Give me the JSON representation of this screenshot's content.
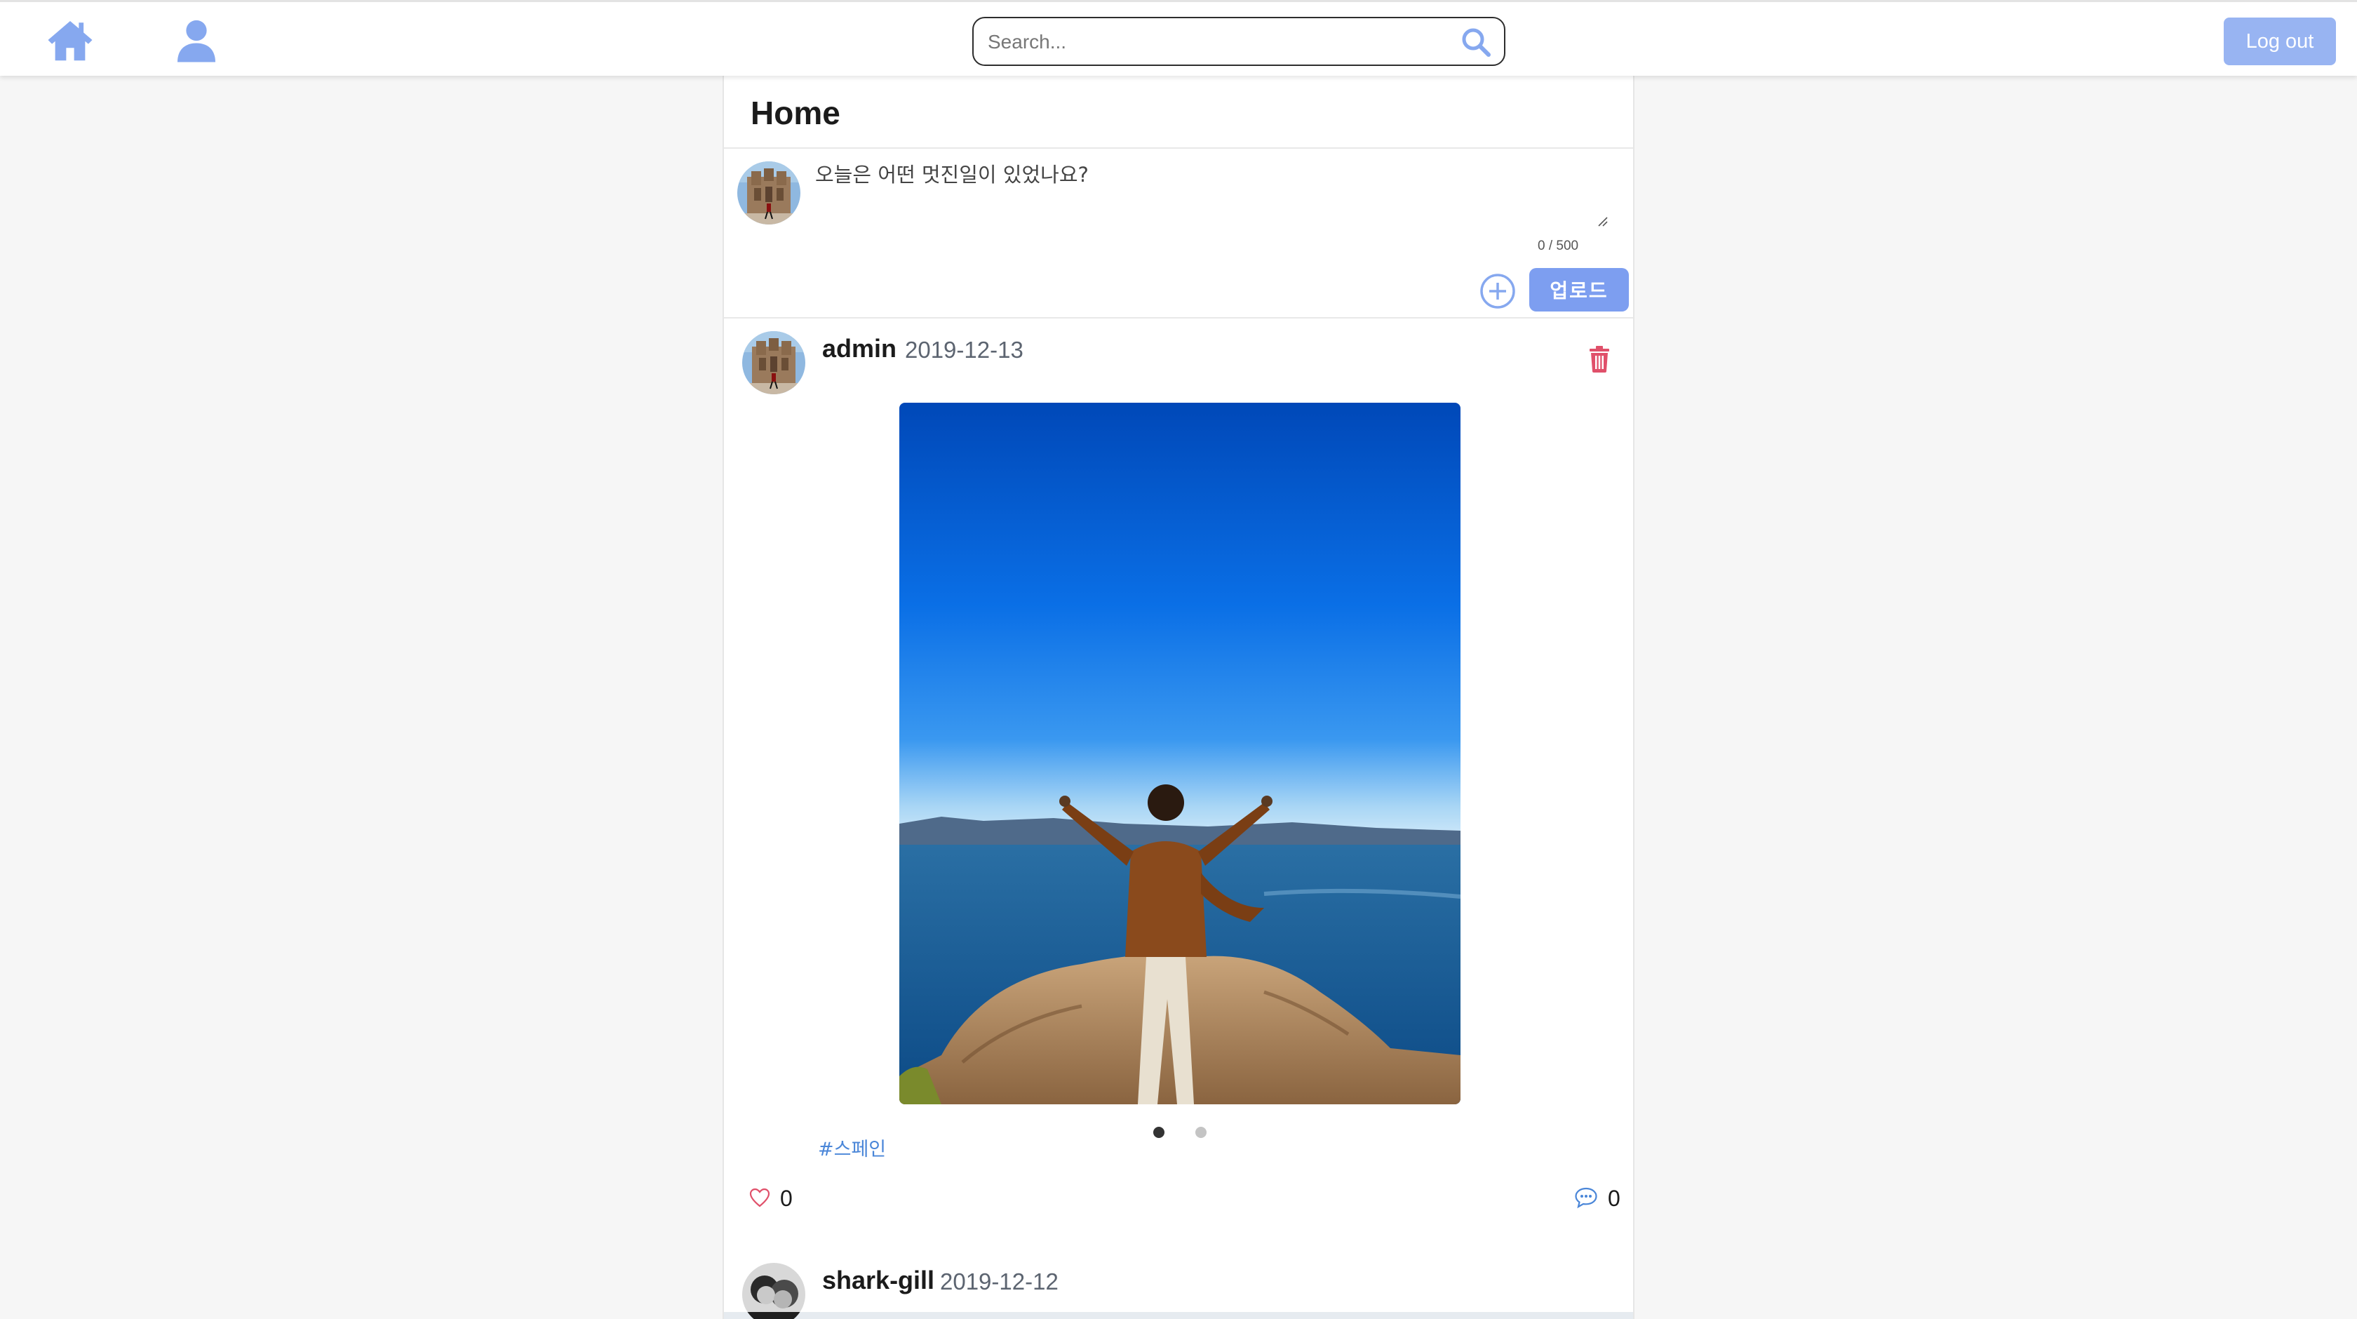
{
  "nav": {
    "home_icon": "home-icon",
    "profile_icon": "user-icon",
    "search_placeholder": "Search...",
    "search_icon": "search-icon",
    "logout_label": "Log out",
    "accent_color": "#98b4f2"
  },
  "page": {
    "title": "Home"
  },
  "composer": {
    "placeholder": "오늘은 어떤 멋진일이 있었나요?",
    "char_count": "0 / 500",
    "add_media_icon": "plus-circle-icon",
    "upload_label": "업로드",
    "upload_color": "#7d9ef0"
  },
  "posts": [
    {
      "author": "admin",
      "date": "2019-12-13",
      "delete_icon": "trash-icon",
      "image_slides_total": 2,
      "image_slide_active": 1,
      "hashtags": [
        "#스페인"
      ],
      "likes": "0",
      "comments": "0",
      "like_icon": "heart-icon",
      "comment_icon": "comment-icon"
    },
    {
      "author": "shark-gill",
      "date": "2019-12-12"
    }
  ]
}
